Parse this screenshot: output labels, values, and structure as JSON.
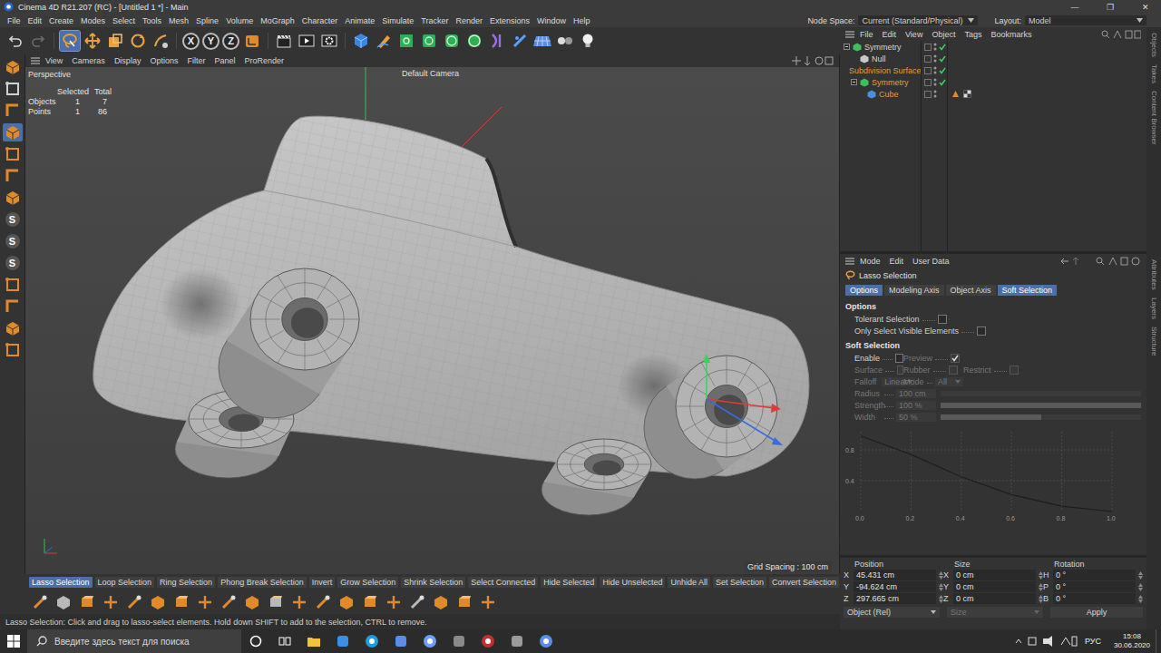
{
  "window": {
    "title": "Cinema 4D R21.207 (RC) - [Untitled 1 *] - Main",
    "controls": [
      "—",
      "❐",
      "✕"
    ]
  },
  "menu": [
    "File",
    "Edit",
    "Create",
    "Modes",
    "Select",
    "Tools",
    "Mesh",
    "Spline",
    "Volume",
    "MoGraph",
    "Character",
    "Animate",
    "Simulate",
    "Tracker",
    "Render",
    "Extensions",
    "Window",
    "Help"
  ],
  "node_space": {
    "label": "Node Space:",
    "value": "Current (Standard/Physical)"
  },
  "layout": {
    "label": "Layout:",
    "value": "Model"
  },
  "toolbar": {
    "undo": {
      "disabled": false
    },
    "redo": {
      "disabled": true
    },
    "tools": [
      {
        "selected": true
      },
      {
        "selected": false
      },
      {
        "selected": false
      },
      {
        "selected": false
      },
      {
        "selected": false
      }
    ],
    "axes": [
      {
        "label": "X",
        "on": true
      },
      {
        "label": "Y",
        "on": true
      },
      {
        "label": "Z",
        "on": true
      }
    ]
  },
  "left_tools": [
    {
      "kind": "icon",
      "label": "",
      "selected": false
    },
    {
      "kind": "icon",
      "label": "",
      "selected": false
    },
    {
      "kind": "icon",
      "label": "",
      "selected": false
    },
    {
      "kind": "icon",
      "label": "",
      "selected": true
    },
    {
      "kind": "icon",
      "label": "",
      "selected": false
    },
    {
      "kind": "icon",
      "label": "",
      "selected": false
    },
    {
      "kind": "icon",
      "label": "",
      "selected": false
    },
    {
      "kind": "letter",
      "label": "S",
      "selected": false
    },
    {
      "kind": "letter",
      "label": "S",
      "selected": false
    },
    {
      "kind": "letter",
      "label": "S",
      "selected": false
    },
    {
      "kind": "icon",
      "label": "",
      "selected": false
    },
    {
      "kind": "icon",
      "label": "",
      "selected": false
    },
    {
      "kind": "icon",
      "label": "",
      "selected": false
    },
    {
      "kind": "icon",
      "label": "",
      "selected": false
    }
  ],
  "viewport": {
    "menu": [
      "View",
      "Cameras",
      "Display",
      "Options",
      "Filter",
      "Panel",
      "ProRender"
    ],
    "name": "Perspective",
    "camera": "Default Camera",
    "stats": {
      "header": [
        "Selected",
        "Total"
      ],
      "rows": [
        {
          "label": "Objects",
          "selected": "1",
          "total": "7"
        },
        {
          "label": "Points",
          "selected": "1",
          "total": "86"
        }
      ]
    },
    "grid": "Grid Spacing : 100 cm"
  },
  "selection_bar": [
    {
      "label": "Lasso Selection",
      "selected": true
    },
    {
      "label": "Loop Selection",
      "selected": false
    },
    {
      "label": "Ring Selection",
      "selected": false
    },
    {
      "label": "Phong Break Selection",
      "selected": false
    },
    {
      "label": "Invert",
      "selected": false
    },
    {
      "label": "Grow Selection",
      "selected": false
    },
    {
      "label": "Shrink Selection",
      "selected": false
    },
    {
      "label": "Select Connected",
      "selected": false
    },
    {
      "label": "Hide Selected",
      "selected": false
    },
    {
      "label": "Hide Unselected",
      "selected": false
    },
    {
      "label": "Unhide All",
      "selected": false
    },
    {
      "label": "Set Selection",
      "selected": false
    },
    {
      "label": "Convert Selection",
      "selected": false
    }
  ],
  "status": "Lasso Selection: Click and drag to lasso-select elements. Hold down SHIFT to add to the selection, CTRL to remove.",
  "objects": {
    "menu": [
      "File",
      "Edit",
      "View",
      "Object",
      "Tags",
      "Bookmarks"
    ],
    "items": [
      {
        "name": "Symmetry",
        "depth": 0,
        "children": true,
        "expanded": true,
        "selected": false,
        "enabled": true,
        "tags": 0,
        "color": "#3fbf5a"
      },
      {
        "name": "Null",
        "depth": 1,
        "children": false,
        "expanded": false,
        "selected": false,
        "enabled": true,
        "tags": 0,
        "color": "#c8c8c8"
      },
      {
        "name": "Subdivision Surface",
        "depth": 0,
        "children": true,
        "expanded": true,
        "selected": true,
        "enabled": true,
        "tags": 0,
        "color": "#3fbf5a"
      },
      {
        "name": "Symmetry",
        "depth": 1,
        "children": true,
        "expanded": true,
        "selected": true,
        "enabled": true,
        "tags": 0,
        "color": "#3fbf5a"
      },
      {
        "name": "Cube",
        "depth": 2,
        "children": false,
        "expanded": false,
        "selected": true,
        "enabled": false,
        "tags": 2,
        "color": "#4a8fe0"
      }
    ]
  },
  "attributes": {
    "menu": [
      "Mode",
      "Edit",
      "User Data"
    ],
    "title": "Lasso Selection",
    "tabs": [
      {
        "label": "Options",
        "selected": true
      },
      {
        "label": "Modeling Axis",
        "selected": false
      },
      {
        "label": "Object Axis",
        "selected": false
      },
      {
        "label": "Soft Selection",
        "selected": true
      }
    ],
    "options": {
      "heading": "Options",
      "fields": [
        {
          "label": "Tolerant Selection",
          "checked": false,
          "disabled": false
        },
        {
          "label": "Only Select Visible Elements",
          "checked": false,
          "disabled": false
        }
      ]
    },
    "soft": {
      "heading": "Soft Selection",
      "check_rows": [
        [
          {
            "label": "Enable",
            "checked": false,
            "disabled": false
          },
          {
            "label": "Preview",
            "checked": true,
            "disabled": true
          }
        ],
        [
          {
            "label": "Surface",
            "checked": false,
            "disabled": true
          },
          {
            "label": "Rubber",
            "checked": false,
            "disabled": true
          },
          {
            "label": "Restrict",
            "checked": false,
            "disabled": true
          }
        ]
      ],
      "dropdowns": [
        {
          "label": "Falloff",
          "value": "Linear",
          "disabled": true
        },
        {
          "label": "Mode",
          "value": "All",
          "disabled": true
        }
      ],
      "sliders": [
        {
          "label": "Radius",
          "value": "100 cm",
          "level": 0.0,
          "disabled": true
        },
        {
          "label": "Strength",
          "value": "100 %",
          "level": 1.0,
          "disabled": true
        },
        {
          "label": "Width",
          "value": "50 %",
          "level": 0.5,
          "disabled": true
        }
      ],
      "graph": {
        "y_ticks": [
          {
            "label": "0.8",
            "value": 0.8
          },
          {
            "label": "0.4",
            "value": 0.4
          }
        ],
        "x_ticks": [
          "0.0",
          "0.2",
          "0.4",
          "0.6",
          "0.8",
          "1.0"
        ],
        "values": [
          0.98,
          0.74,
          0.45,
          0.22,
          0.07,
          0.0
        ]
      }
    }
  },
  "coordinates": {
    "headers": [
      "Position",
      "Size",
      "Rotation"
    ],
    "rows": [
      {
        "pos_axis": "X",
        "pos": "45.431 cm",
        "size_axis": "X",
        "size": "0 cm",
        "rot_axis": "H",
        "rot": "0 °"
      },
      {
        "pos_axis": "Y",
        "pos": "-94.624 cm",
        "size_axis": "Y",
        "size": "0 cm",
        "rot_axis": "P",
        "rot": "0 °"
      },
      {
        "pos_axis": "Z",
        "pos": "297.665 cm",
        "size_axis": "Z",
        "size": "0 cm",
        "rot_axis": "B",
        "rot": "0 °"
      }
    ],
    "mode": "Object (Rel)",
    "size_mode": "Size",
    "size_mode_disabled": true,
    "apply": "Apply"
  },
  "side_tabs": [
    [
      "Objects",
      "Takes",
      "Content Browser"
    ],
    [
      "Attributes",
      "Layers",
      "Structure"
    ]
  ],
  "taskbar": {
    "search": "Введите здесь текст для поиска",
    "lang": "РУС",
    "time": "15:08",
    "date": "30.06.2020"
  }
}
